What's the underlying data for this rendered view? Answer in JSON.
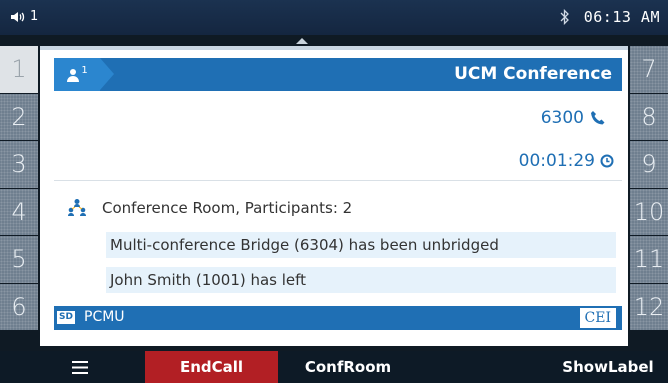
{
  "status": {
    "volume_level": "1",
    "bluetooth_icon": "bluetooth-icon",
    "time": "06:13 AM"
  },
  "side_keys": {
    "left": [
      "1",
      "2",
      "3",
      "4",
      "5",
      "6"
    ],
    "right": [
      "7",
      "8",
      "9",
      "10",
      "11",
      "12"
    ]
  },
  "call": {
    "line_count": "1",
    "title": "UCM Conference",
    "number": "6300",
    "duration": "00:01:29"
  },
  "conference": {
    "room_text": "Conference Room, Participants: 2",
    "messages": [
      "Multi-conference Bridge (6304) has been unbridged",
      "John Smith (1001) has left"
    ]
  },
  "codec_bar": {
    "sd_badge": "SD",
    "codec": "PCMU",
    "cei_label": "CEI"
  },
  "softkeys": {
    "end_call": "EndCall",
    "conf_room": "ConfRoom",
    "show_label": "ShowLabel"
  },
  "colors": {
    "accent": "#1f6fb4",
    "end_call": "#b21f24",
    "highlight": "#e6f2fb"
  }
}
